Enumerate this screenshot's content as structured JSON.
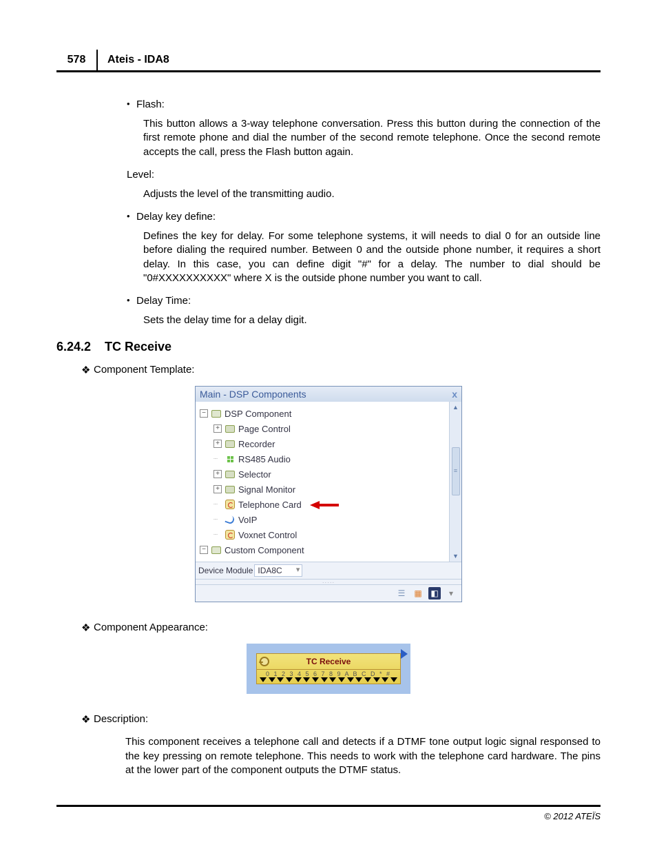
{
  "header": {
    "page_number": "578",
    "doc_title": "Ateis - IDA8"
  },
  "bullets": {
    "flash": {
      "label": "Flash:",
      "body": "This button allows a 3-way telephone conversation. Press this button during the connection of the first remote phone and dial the number of the second remote telephone. Once the second remote accepts the call, press the Flash button again."
    },
    "level": {
      "label": "Level:",
      "body": "Adjusts the level of the transmitting audio."
    },
    "delay_key": {
      "label": "Delay key define:",
      "body": "Defines the key for delay. For some telephone systems, it will needs to dial 0 for an outside line before dialing the required number. Between 0 and the outside phone number, it requires a short delay. In this case, you can define digit \"#\" for a delay. The number to dial should be \"0#XXXXXXXXXX\" where X is the outside phone number you want to call."
    },
    "delay_time": {
      "label": "Delay Time:",
      "body": "Sets the delay time for a delay digit."
    }
  },
  "section": {
    "number": "6.24.2",
    "title": "TC Receive"
  },
  "subheads": {
    "template": "Component Template:",
    "appearance": "Component Appearance:",
    "description": "Description:"
  },
  "panel": {
    "title": "Main - DSP Components",
    "close": "x",
    "tree": {
      "root": "DSP Component",
      "items": [
        "Page Control",
        "Recorder",
        "RS485 Audio",
        "Selector",
        "Signal Monitor",
        "Telephone Card",
        "VoIP",
        "Voxnet Control"
      ],
      "root2": "Custom Component"
    },
    "device_label": "Device Module",
    "device_value": "IDA8C"
  },
  "component": {
    "title": "TC Receive",
    "nums": "0 1 2 3 4 5 6 7 8 9 A B C D * #"
  },
  "description_body": "This component receives a telephone call and detects if a DTMF tone output logic signal responsed to the key pressing on remote telephone. This needs to work with the telephone card hardware. The pins at the lower part of the component outputs the DTMF status.",
  "footer": "© 2012 ATEÏS"
}
